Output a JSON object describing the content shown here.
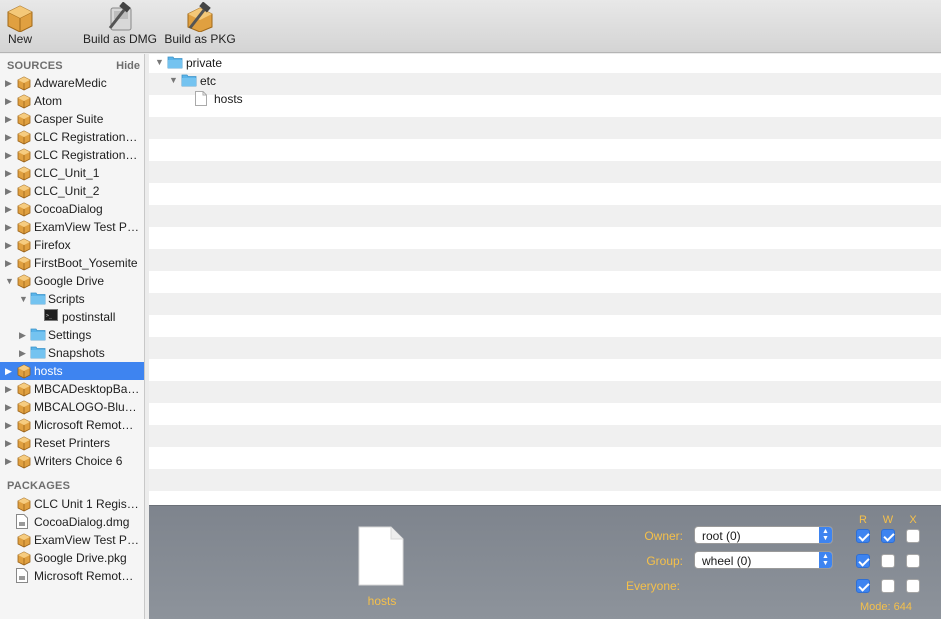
{
  "toolbar": {
    "new_label": "New",
    "dmg_label": "Build as DMG",
    "pkg_label": "Build as PKG"
  },
  "sidebar": {
    "sources_heading": "SOURCES",
    "hide_label": "Hide",
    "sources": [
      {
        "label": "AdwareMedic",
        "icon": "package-icon",
        "expanded": false,
        "depth": 0
      },
      {
        "label": "Atom",
        "icon": "package-icon",
        "expanded": false,
        "depth": 0
      },
      {
        "label": "Casper Suite",
        "icon": "package-icon",
        "expanded": false,
        "depth": 0
      },
      {
        "label": "CLC Registration…",
        "icon": "package-icon",
        "expanded": false,
        "depth": 0
      },
      {
        "label": "CLC Registration…",
        "icon": "package-icon",
        "expanded": false,
        "depth": 0
      },
      {
        "label": "CLC_Unit_1",
        "icon": "package-icon",
        "expanded": false,
        "depth": 0
      },
      {
        "label": "CLC_Unit_2",
        "icon": "package-icon",
        "expanded": false,
        "depth": 0
      },
      {
        "label": "CocoaDialog",
        "icon": "package-icon",
        "expanded": false,
        "depth": 0
      },
      {
        "label": "ExamView Test Pl…",
        "icon": "package-icon",
        "expanded": false,
        "depth": 0
      },
      {
        "label": "Firefox",
        "icon": "package-icon",
        "expanded": false,
        "depth": 0
      },
      {
        "label": "FirstBoot_Yosemite",
        "icon": "package-icon",
        "expanded": false,
        "depth": 0
      },
      {
        "label": "Google Drive",
        "icon": "package-icon",
        "expanded": true,
        "depth": 0
      },
      {
        "label": "Scripts",
        "icon": "folder-icon",
        "expanded": true,
        "depth": 1
      },
      {
        "label": "postinstall",
        "icon": "terminal-icon",
        "expanded": null,
        "depth": 2
      },
      {
        "label": "Settings",
        "icon": "folder-icon",
        "expanded": false,
        "depth": 1
      },
      {
        "label": "Snapshots",
        "icon": "folder-icon",
        "expanded": false,
        "depth": 1
      },
      {
        "label": "hosts",
        "icon": "package-icon",
        "expanded": false,
        "depth": 0,
        "selected": true
      },
      {
        "label": "MBCADesktopBa…",
        "icon": "package-icon",
        "expanded": false,
        "depth": 0
      },
      {
        "label": "MBCALOGO-Blu…",
        "icon": "package-icon",
        "expanded": false,
        "depth": 0
      },
      {
        "label": "Microsoft Remot…",
        "icon": "package-icon",
        "expanded": false,
        "depth": 0
      },
      {
        "label": "Reset Printers",
        "icon": "package-icon",
        "expanded": false,
        "depth": 0
      },
      {
        "label": "Writers Choice 6",
        "icon": "package-icon",
        "expanded": false,
        "depth": 0
      }
    ],
    "packages_heading": "PACKAGES",
    "packages": [
      {
        "label": "CLC Unit 1 Regis…",
        "icon": "package-icon"
      },
      {
        "label": "CocoaDialog.dmg",
        "icon": "dmg-file-icon"
      },
      {
        "label": "ExamView Test Pl…",
        "icon": "package-icon"
      },
      {
        "label": "Google Drive.pkg",
        "icon": "package-icon"
      },
      {
        "label": "Microsoft Remot…",
        "icon": "dmg-file-icon"
      }
    ]
  },
  "files": {
    "items": [
      {
        "label": "private",
        "icon": "folder-icon",
        "expanded": true,
        "depth": 0
      },
      {
        "label": "etc",
        "icon": "folder-icon",
        "expanded": true,
        "depth": 1
      },
      {
        "label": "hosts",
        "icon": "document-icon",
        "expanded": null,
        "depth": 2
      }
    ]
  },
  "info": {
    "file_name": "hosts",
    "owner_label": "Owner:",
    "owner_value": "root (0)",
    "group_label": "Group:",
    "group_value": "wheel (0)",
    "everyone_label": "Everyone:",
    "rwx_headers": [
      "R",
      "W",
      "X"
    ],
    "permissions": {
      "owner": [
        true,
        true,
        false
      ],
      "group": [
        true,
        false,
        false
      ],
      "everyone": [
        true,
        false,
        false
      ]
    },
    "mode_text": "Mode: 644"
  },
  "colors": {
    "selection": "#3e84f0",
    "label_accent": "#f5c04a",
    "folder": "#5ab4ea"
  }
}
